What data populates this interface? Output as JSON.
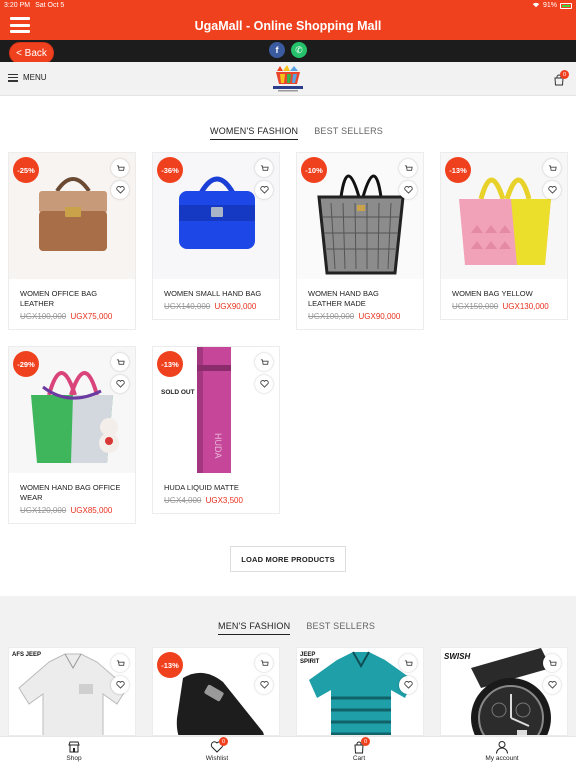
{
  "status": {
    "time": "3:20 PM",
    "date": "Sat Oct 5",
    "battery": "91%"
  },
  "header": {
    "title": "UgaMall - Online Shopping Mall"
  },
  "back_label": "< Back",
  "social": {
    "facebook": "f",
    "whatsapp": "✆"
  },
  "navbar": {
    "menu_label": "MENU",
    "cart_count": "0"
  },
  "womens": {
    "tabs": [
      {
        "label": "WOMEN'S FASHION"
      },
      {
        "label": "BEST SELLERS"
      }
    ],
    "products": [
      {
        "name": "WOMEN OFFICE BAG LEATHER",
        "discount": "-25%",
        "old_price": "UGX100,000",
        "new_price": "UGX75,000"
      },
      {
        "name": "WOMEN SMALL HAND BAG",
        "discount": "-36%",
        "old_price": "UGX140,000",
        "new_price": "UGX90,000"
      },
      {
        "name": "WOMEN HAND BAG LEATHER MADE",
        "discount": "-10%",
        "old_price": "UGX100,000",
        "new_price": "UGX90,000"
      },
      {
        "name": "WOMEN BAG YELLOW",
        "discount": "-13%",
        "old_price": "UGX150,000",
        "new_price": "UGX130,000"
      },
      {
        "name": "WOMEN HAND BAG OFFICE WEAR",
        "discount": "-29%",
        "old_price": "UGX120,000",
        "new_price": "UGX85,000"
      },
      {
        "name": "HUDA LIQUID MATTE",
        "discount": "-13%",
        "old_price": "UGX4,000",
        "new_price": "UGX3,500",
        "sold_out": "SOLD OUT"
      }
    ],
    "load_more": "LOAD MORE PRODUCTS"
  },
  "mens": {
    "tabs": [
      {
        "label": "MEN'S FASHION"
      },
      {
        "label": "BEST SELLERS"
      }
    ],
    "products": [
      {
        "brand": "AFS JEEP"
      },
      {
        "discount": "-13%"
      },
      {
        "brand": "JEEP SPIRIT"
      },
      {
        "brand": "SWISH"
      }
    ]
  },
  "bottom_nav": [
    {
      "label": "Shop"
    },
    {
      "label": "Wishlist",
      "count": "0"
    },
    {
      "label": "Cart",
      "count": "0"
    },
    {
      "label": "My account"
    }
  ],
  "colors": {
    "accent": "#f0411f",
    "dark_bar": "#1c1c1c",
    "price_red": "#e8301d"
  }
}
